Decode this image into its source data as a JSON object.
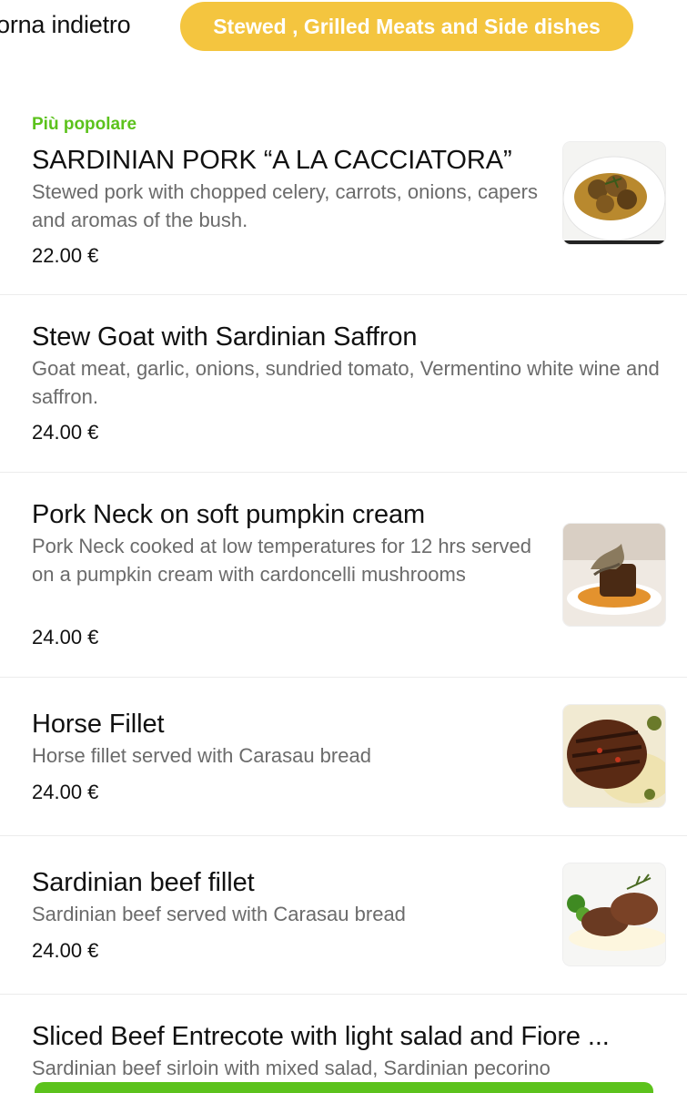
{
  "header": {
    "back_label": "orna indietro",
    "category_label": "Stewed , Grilled Meats and Side dishes"
  },
  "items": [
    {
      "badge": "Più popolare",
      "name": "SARDINIAN PORK “A LA CACCIATORA”",
      "description": "Stewed pork with chopped celery, carrots, onions, capers and aromas of the bush.",
      "price": "22.00 €"
    },
    {
      "name": "Stew Goat with Sardinian Saffron",
      "description": "Goat meat, garlic, onions, sundried tomato, Vermentino white wine and saffron.",
      "price": "24.00 €"
    },
    {
      "name": "Pork Neck on soft pumpkin cream",
      "description": "Pork Neck cooked at low temperatures for 12 hrs served on a pumpkin cream with cardoncelli mushrooms",
      "price": "24.00 €"
    },
    {
      "name": "Horse Fillet",
      "description": "Horse fillet served with Carasau bread",
      "price": "24.00 €"
    },
    {
      "name": "Sardinian beef fillet",
      "description": "Sardinian beef served with Carasau bread",
      "price": "24.00 €"
    },
    {
      "name": "Sliced Beef Entrecote with light salad and Fiore ...",
      "description": "Sardinian beef sirloin with mixed salad, Sardinian pecorino"
    }
  ],
  "colors": {
    "accent_yellow": "#f4c53f",
    "accent_green": "#5cc21c"
  }
}
